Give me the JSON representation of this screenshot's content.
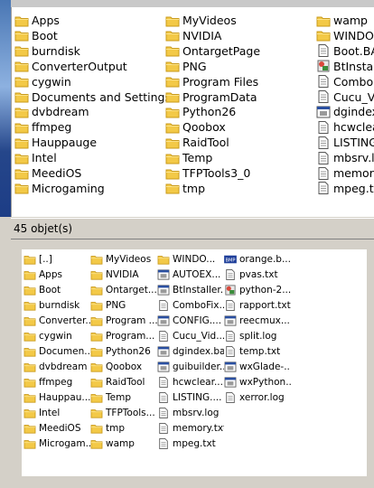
{
  "status": {
    "count_text": "45 objet(s)"
  },
  "top_list": {
    "col1": [
      {
        "name": "Apps",
        "type": "folder"
      },
      {
        "name": "Boot",
        "type": "folder"
      },
      {
        "name": "burndisk",
        "type": "folder"
      },
      {
        "name": "ConverterOutput",
        "type": "folder"
      },
      {
        "name": "cygwin",
        "type": "folder"
      },
      {
        "name": "Documents and Settings",
        "type": "folder"
      },
      {
        "name": "dvbdream",
        "type": "folder"
      },
      {
        "name": "ffmpeg",
        "type": "folder"
      },
      {
        "name": "Hauppauge",
        "type": "folder"
      },
      {
        "name": "Intel",
        "type": "folder"
      },
      {
        "name": "MeediOS",
        "type": "folder"
      },
      {
        "name": "Microgaming",
        "type": "folder"
      }
    ],
    "col2": [
      {
        "name": "MyVideos",
        "type": "folder"
      },
      {
        "name": "NVIDIA",
        "type": "folder"
      },
      {
        "name": "OntargetPage",
        "type": "folder"
      },
      {
        "name": "PNG",
        "type": "folder"
      },
      {
        "name": "Program Files",
        "type": "folder"
      },
      {
        "name": "ProgramData",
        "type": "folder"
      },
      {
        "name": "Python26",
        "type": "folder"
      },
      {
        "name": "Qoobox",
        "type": "folder"
      },
      {
        "name": "RaidTool",
        "type": "folder"
      },
      {
        "name": "Temp",
        "type": "folder"
      },
      {
        "name": "TFPTools3_0",
        "type": "folder"
      },
      {
        "name": "tmp",
        "type": "folder"
      }
    ],
    "col3": [
      {
        "name": "wamp",
        "type": "folder"
      },
      {
        "name": "WINDOWS",
        "type": "folder"
      },
      {
        "name": "Boot.BAK",
        "type": "file"
      },
      {
        "name": "BtInstaller",
        "type": "app"
      },
      {
        "name": "ComboF",
        "type": "file"
      },
      {
        "name": "Cucu_Vid",
        "type": "file"
      },
      {
        "name": "dgindex.",
        "type": "window"
      },
      {
        "name": "hcwclear",
        "type": "file"
      },
      {
        "name": "LISTING.",
        "type": "file"
      },
      {
        "name": "mbsrv.lo",
        "type": "file"
      },
      {
        "name": "memory",
        "type": "file"
      },
      {
        "name": "mpeg.txt",
        "type": "file"
      }
    ]
  },
  "bottom_list": {
    "col1": [
      {
        "name": "[..]",
        "type": "folder"
      },
      {
        "name": "Apps",
        "type": "folder"
      },
      {
        "name": "Boot",
        "type": "folder"
      },
      {
        "name": "burndisk",
        "type": "folder"
      },
      {
        "name": "Converter...",
        "type": "folder"
      },
      {
        "name": "cygwin",
        "type": "folder"
      },
      {
        "name": "Documen...",
        "type": "folder"
      },
      {
        "name": "dvbdream",
        "type": "folder"
      },
      {
        "name": "ffmpeg",
        "type": "folder"
      },
      {
        "name": "Hauppau...",
        "type": "folder"
      },
      {
        "name": "Intel",
        "type": "folder"
      },
      {
        "name": "MeediOS",
        "type": "folder"
      },
      {
        "name": "Microgam...",
        "type": "folder"
      }
    ],
    "col2": [
      {
        "name": "MyVideos",
        "type": "folder"
      },
      {
        "name": "NVIDIA",
        "type": "folder"
      },
      {
        "name": "Ontarget...",
        "type": "folder"
      },
      {
        "name": "PNG",
        "type": "folder"
      },
      {
        "name": "Program ...",
        "type": "folder"
      },
      {
        "name": "Program...",
        "type": "folder"
      },
      {
        "name": "Python26",
        "type": "folder"
      },
      {
        "name": "Qoobox",
        "type": "folder"
      },
      {
        "name": "RaidTool",
        "type": "folder"
      },
      {
        "name": "Temp",
        "type": "folder"
      },
      {
        "name": "TFPTools...",
        "type": "folder"
      },
      {
        "name": "tmp",
        "type": "folder"
      },
      {
        "name": "wamp",
        "type": "folder"
      }
    ],
    "col3": [
      {
        "name": "WINDO...",
        "type": "folder"
      },
      {
        "name": "AUTOEX...",
        "type": "window"
      },
      {
        "name": "BtInstaller...",
        "type": "window"
      },
      {
        "name": "ComboFix...",
        "type": "file"
      },
      {
        "name": "CONFIG....",
        "type": "window"
      },
      {
        "name": "Cucu_Vid...",
        "type": "file"
      },
      {
        "name": "dgindex.bat",
        "type": "window"
      },
      {
        "name": "guibuilder...",
        "type": "window"
      },
      {
        "name": "hcwclear...",
        "type": "file"
      },
      {
        "name": "LISTING....",
        "type": "file"
      },
      {
        "name": "mbsrv.log",
        "type": "file"
      },
      {
        "name": "memory.txt",
        "type": "file"
      },
      {
        "name": "mpeg.txt",
        "type": "file"
      }
    ],
    "col4": [
      {
        "name": "orange.b...",
        "type": "bmp"
      },
      {
        "name": "pvas.txt",
        "type": "file"
      },
      {
        "name": "python-2....",
        "type": "app"
      },
      {
        "name": "rapport.txt",
        "type": "file"
      },
      {
        "name": "reecmux...",
        "type": "window"
      },
      {
        "name": "split.log",
        "type": "file"
      },
      {
        "name": "temp.txt",
        "type": "file"
      },
      {
        "name": "wxGlade-...",
        "type": "window"
      },
      {
        "name": "wxPython...",
        "type": "window"
      },
      {
        "name": "xerror.log",
        "type": "file"
      }
    ]
  },
  "colors": {
    "folder": "#f3c947",
    "folder_dark": "#c99a1a",
    "window_blue": "#2a4fa0",
    "panel": "#d4d0c8"
  }
}
